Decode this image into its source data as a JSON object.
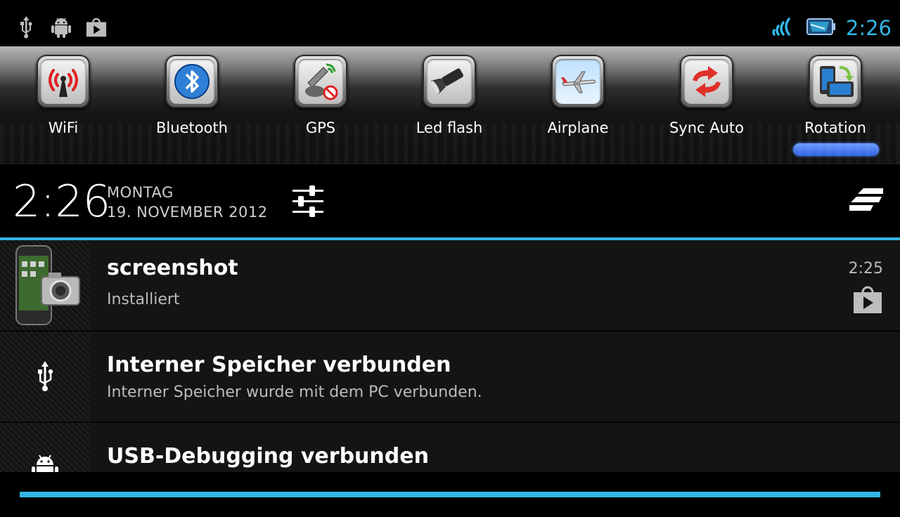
{
  "status_bar": {
    "left_icons": [
      "usb-icon",
      "android-icon",
      "play-store-icon"
    ],
    "right_icons": [
      "signal-icon",
      "battery-icon"
    ],
    "time": "2:26",
    "accent": "#33b5e5"
  },
  "toggles": [
    {
      "label": "WiFi",
      "icon": "wifi-tower-icon"
    },
    {
      "label": "Bluetooth",
      "icon": "bluetooth-icon"
    },
    {
      "label": "GPS",
      "icon": "gps-satellite-icon"
    },
    {
      "label": "Led flash",
      "icon": "flashlight-icon"
    },
    {
      "label": "Airplane",
      "icon": "airplane-icon"
    },
    {
      "label": "Sync Auto",
      "icon": "sync-icon"
    },
    {
      "label": "Rotation",
      "icon": "rotation-icon",
      "active": true
    }
  ],
  "header": {
    "time": "2:26",
    "day": "MONTAG",
    "date": "19. NOVEMBER 2012"
  },
  "notifications": [
    {
      "title": "screenshot",
      "text": "Installiert",
      "time": "2:25",
      "icon": "phone-camera-icon",
      "small_icon": "play-store-icon"
    },
    {
      "title": "Interner Speicher verbunden",
      "text": "Interner Speicher wurde mit dem PC verbunden.",
      "icon": "usb-icon"
    },
    {
      "title": "USB-Debugging verbunden",
      "icon": "android-icon"
    }
  ]
}
